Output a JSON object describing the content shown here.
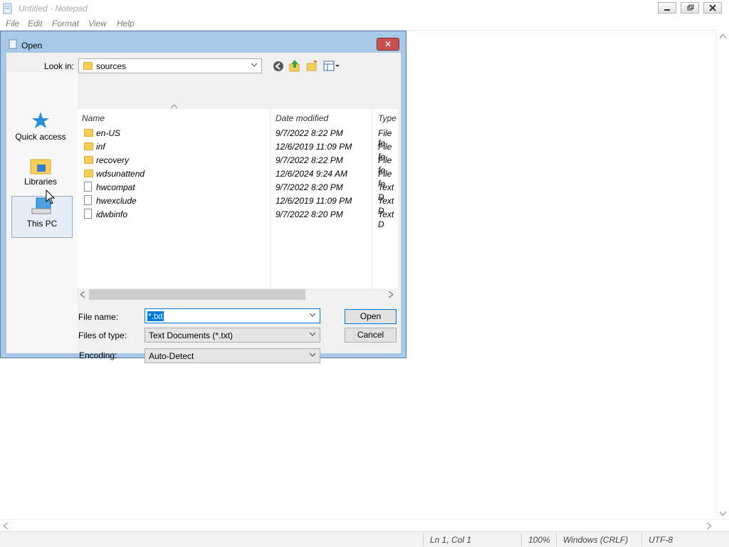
{
  "notepad": {
    "title": "Untitled - Notepad",
    "menu": [
      "File",
      "Edit",
      "Format",
      "View",
      "Help"
    ],
    "status": {
      "position": "Ln 1, Col 1",
      "zoom": "100%",
      "line_ending": "Windows (CRLF)",
      "encoding": "UTF-8"
    }
  },
  "dialog": {
    "title": "Open",
    "close_label": "✕",
    "look_in_label": "Look in:",
    "look_in_value": "sources",
    "places": [
      {
        "label": "Quick access",
        "icon": "star-icon"
      },
      {
        "label": "Libraries",
        "icon": "libraries-icon"
      },
      {
        "label": "This PC",
        "icon": "computer-icon"
      }
    ],
    "columns": [
      "Name",
      "Date modified",
      "Type"
    ],
    "files": [
      {
        "name": "en-US",
        "date": "9/7/2022 8:22 PM",
        "type": "File fo",
        "kind": "folder"
      },
      {
        "name": "inf",
        "date": "12/6/2019 11:09 PM",
        "type": "File fo",
        "kind": "folder"
      },
      {
        "name": "recovery",
        "date": "9/7/2022 8:22 PM",
        "type": "File fo",
        "kind": "folder"
      },
      {
        "name": "wdsunattend",
        "date": "12/6/2024 9:24 AM",
        "type": "File fo",
        "kind": "folder"
      },
      {
        "name": "hwcompat",
        "date": "9/7/2022 8:20 PM",
        "type": "Text D",
        "kind": "file"
      },
      {
        "name": "hwexclude",
        "date": "12/6/2019 11:09 PM",
        "type": "Text D",
        "kind": "file"
      },
      {
        "name": "idwbinfo",
        "date": "9/7/2022 8:20 PM",
        "type": "Text D",
        "kind": "file"
      }
    ],
    "file_name_label": "File name:",
    "file_name_value": "*.txt",
    "files_of_type_label": "Files of type:",
    "files_of_type_value": "Text Documents (*.txt)",
    "encoding_label": "Encoding:",
    "encoding_value": "Auto-Detect",
    "open_button": "Open",
    "cancel_button": "Cancel"
  },
  "colors": {
    "dialog_frame": "#a9c9e8",
    "close_button": "#c75050",
    "folder": "#f6cf5a",
    "selection": "#0078d7"
  }
}
